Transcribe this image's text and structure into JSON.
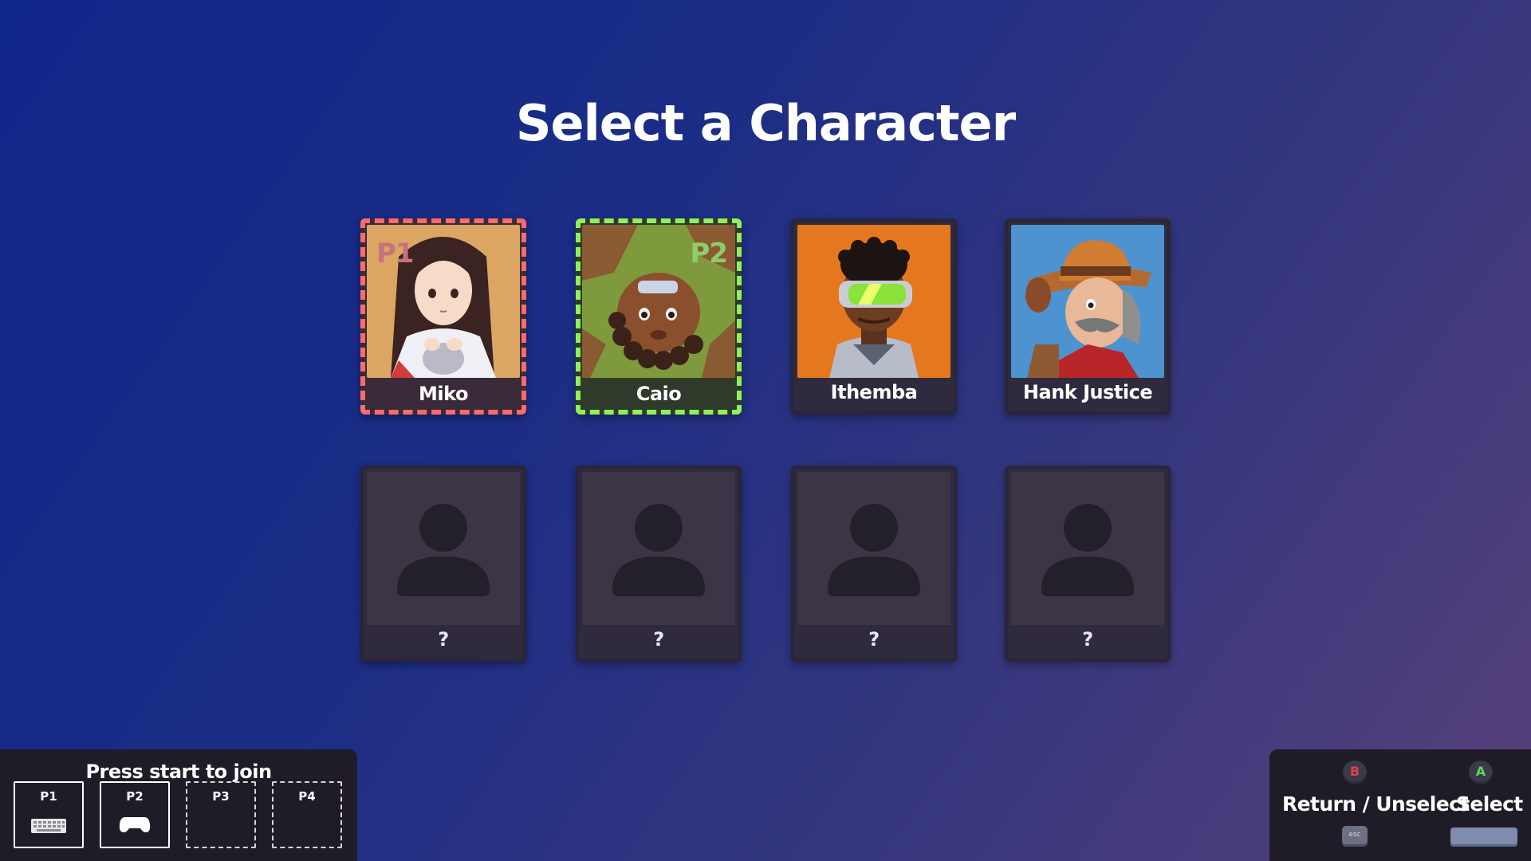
{
  "screen": {
    "title": "Select a Character"
  },
  "characters": [
    {
      "name": "Miko",
      "selected_by": "P1",
      "portrait": "miko-portrait"
    },
    {
      "name": "Caio",
      "selected_by": "P2",
      "portrait": "caio-portrait"
    },
    {
      "name": "Ithemba",
      "selected_by": "",
      "portrait": "ithemba-portrait"
    },
    {
      "name": "Hank Justice",
      "selected_by": "",
      "portrait": "hank-justice-portrait"
    },
    {
      "name": "?",
      "selected_by": "",
      "portrait": "person-silhouette-icon"
    },
    {
      "name": "?",
      "selected_by": "",
      "portrait": "person-silhouette-icon"
    },
    {
      "name": "?",
      "selected_by": "",
      "portrait": "person-silhouette-icon"
    },
    {
      "name": "?",
      "selected_by": "",
      "portrait": "person-silhouette-icon"
    }
  ],
  "join_panel": {
    "title": "Press start to join",
    "slots": [
      {
        "label": "P1",
        "device": "keyboard-icon",
        "joined": true
      },
      {
        "label": "P2",
        "device": "gamepad-icon",
        "joined": true
      },
      {
        "label": "P3",
        "device": "",
        "joined": false
      },
      {
        "label": "P4",
        "device": "",
        "joined": false
      }
    ]
  },
  "controls": {
    "return_label": "Return / Unselect",
    "return_pad_button": "B",
    "return_key": "esc",
    "select_label": "Select",
    "select_pad_button": "A",
    "select_key": "space-key-icon"
  },
  "colors": {
    "p1": "#ff6b6b",
    "p2": "#8ff05a",
    "b_button": "#e0404a",
    "a_button": "#5fd35a"
  }
}
